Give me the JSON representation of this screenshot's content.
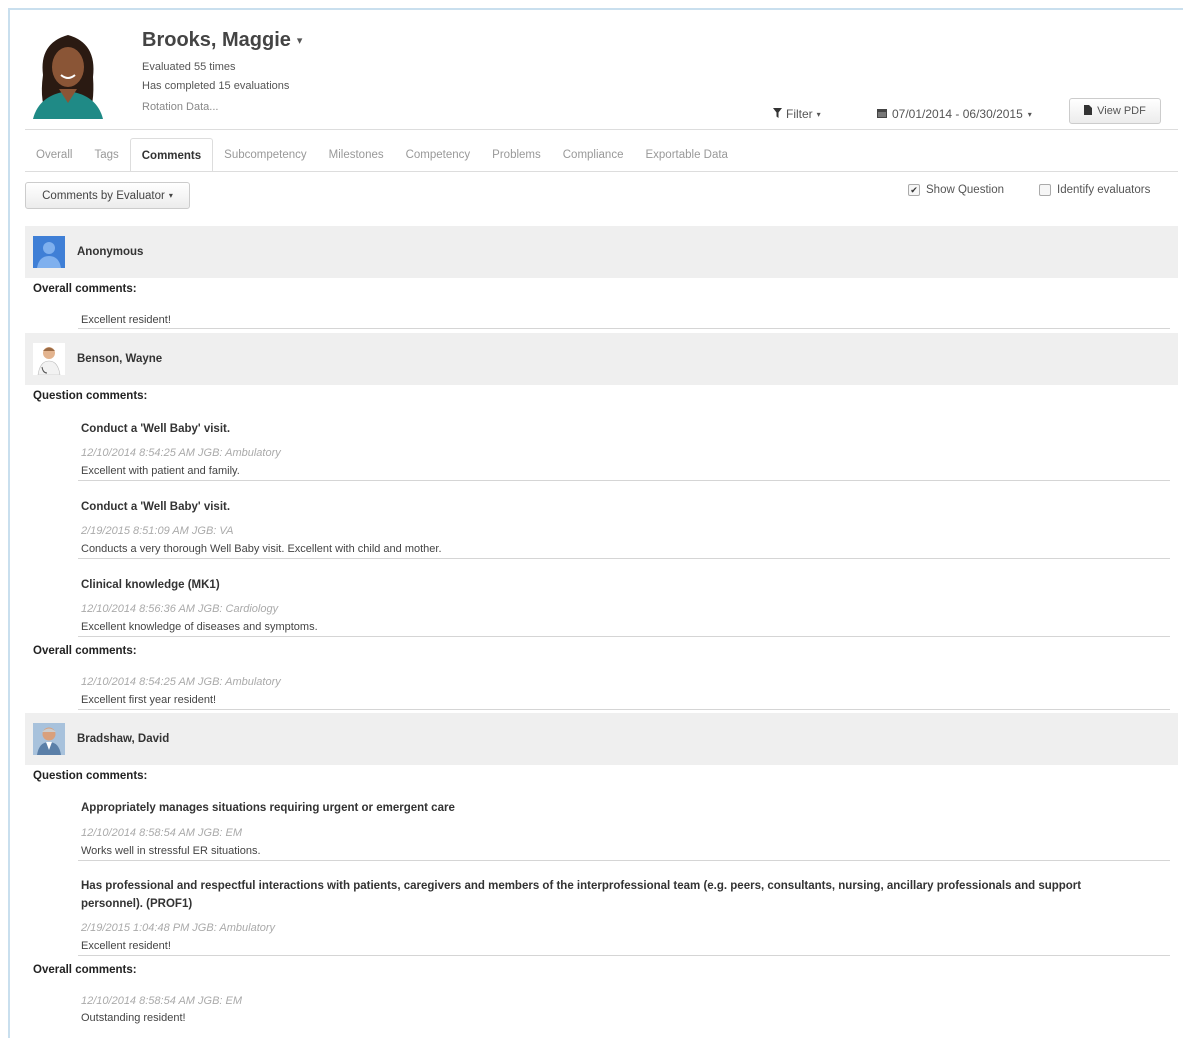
{
  "profile": {
    "name": "Brooks, Maggie",
    "evaluated": "Evaluated 55 times",
    "completed": "Has completed 15 evaluations",
    "rotation": "Rotation Data..."
  },
  "toolbar": {
    "filter_label": "Filter",
    "date_range": "07/01/2014 - 06/30/2015",
    "pdf_label": "View PDF"
  },
  "tabs": [
    {
      "label": "Overall"
    },
    {
      "label": "Tags"
    },
    {
      "label": "Comments",
      "active": true
    },
    {
      "label": "Subcompetency"
    },
    {
      "label": "Milestones"
    },
    {
      "label": "Competency"
    },
    {
      "label": "Problems"
    },
    {
      "label": "Compliance"
    },
    {
      "label": "Exportable Data"
    }
  ],
  "controls": {
    "group_by": "Comments by Evaluator",
    "show_question": "Show Question",
    "show_question_checked": true,
    "identify_evaluators": "Identify evaluators",
    "identify_evaluators_checked": false
  },
  "evaluators": [
    {
      "name": "Anonymous",
      "overall_label": "Overall comments:",
      "overall": {
        "stamp": "",
        "text": "Excellent resident!"
      }
    },
    {
      "name": "Benson, Wayne",
      "question_label": "Question comments:",
      "questions": [
        {
          "title": "Conduct a 'Well Baby' visit.",
          "stamp": "12/10/2014 8:54:25 AM JGB: Ambulatory",
          "text": "Excellent with patient and family."
        },
        {
          "title": "Conduct a 'Well Baby' visit.",
          "stamp": "2/19/2015 8:51:09 AM JGB: VA",
          "text": "Conducts a very thorough Well Baby visit. Excellent with child and mother."
        },
        {
          "title": "Clinical knowledge (MK1)",
          "stamp": "12/10/2014 8:56:36 AM JGB: Cardiology",
          "text": "Excellent knowledge of diseases and symptoms."
        }
      ],
      "overall_label": "Overall comments:",
      "overall": {
        "stamp": "12/10/2014 8:54:25 AM JGB: Ambulatory",
        "text": "Excellent first year resident!"
      }
    },
    {
      "name": "Bradshaw, David",
      "question_label": "Question comments:",
      "questions": [
        {
          "title": "Appropriately manages situations requiring urgent or emergent care",
          "stamp": "12/10/2014 8:58:54 AM JGB: EM",
          "text": "Works well in stressful ER situations."
        },
        {
          "title": "Has professional and respectful interactions with patients, caregivers and members of the interprofessional team (e.g. peers, consultants, nursing, ancillary professionals and support personnel). (PROF1)",
          "stamp": "2/19/2015 1:04:48 PM JGB: Ambulatory",
          "text": "Excellent resident!"
        }
      ],
      "overall_label": "Overall comments:",
      "overall": {
        "stamp": "12/10/2014 8:58:54 AM JGB: EM",
        "text": "Outstanding resident!"
      }
    }
  ]
}
